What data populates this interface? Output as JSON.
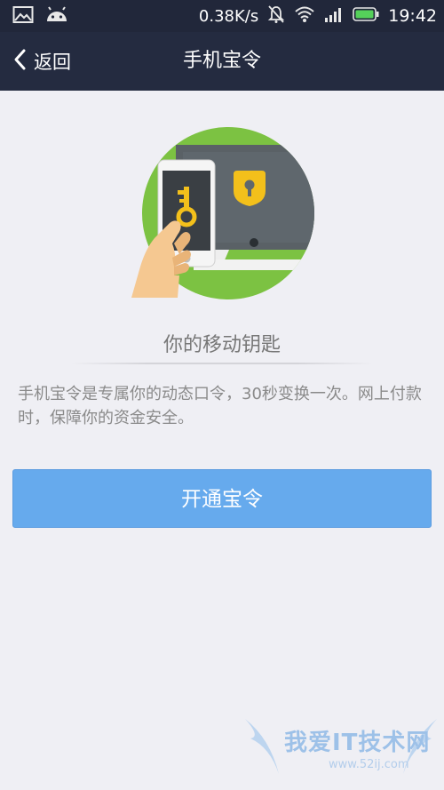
{
  "status_bar": {
    "left_icons": [
      "image-icon",
      "android-icon"
    ],
    "net_speed": "0.38K/s",
    "right_icons": [
      "mute-bell-icon",
      "wifi-icon",
      "signal-icon",
      "battery-icon"
    ],
    "time": "19:42"
  },
  "header": {
    "back_label": "返回",
    "title": "手机宝令"
  },
  "main": {
    "feature_title": "你的移动钥匙",
    "description": "手机宝令是专属你的动态口令，30秒变换一次。网上付款时，保障你的资金安全。",
    "primary_button": "开通宝令"
  },
  "watermark": {
    "title": "我爱IT技术网",
    "url": "www.52ij.com"
  },
  "colors": {
    "status_bar_bg": "#21273a",
    "title_bar_bg": "#242b40",
    "page_bg": "#efeff4",
    "primary_button": "#66aaed",
    "illustration_green": "#7cc242",
    "illustration_key": "#f3c01b"
  }
}
